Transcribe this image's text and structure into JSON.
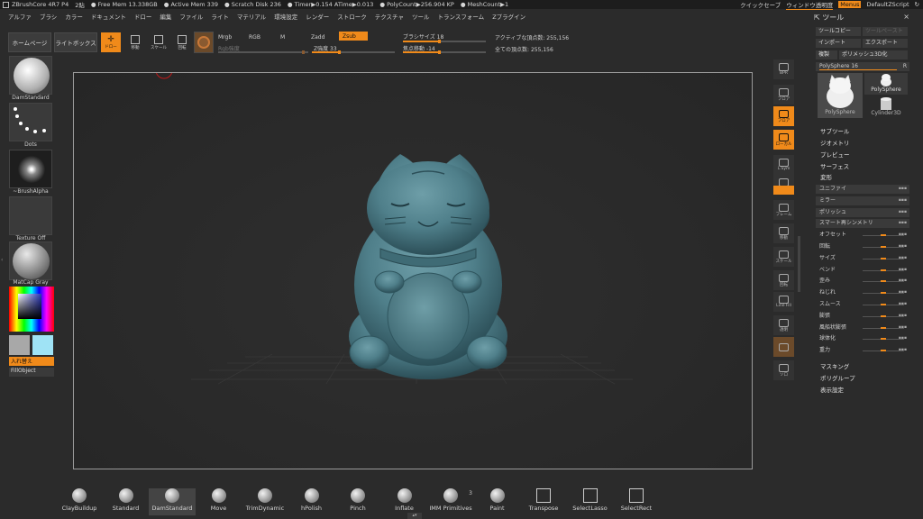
{
  "titlebar": {
    "app": "ZBrushCore 4R7 P4",
    "items": [
      "2貼",
      "● Free Mem 13.338GB",
      "● Active Mem 339",
      "● Scratch Disk 236",
      "● Timer▶0.154 ATime▶0.013",
      "● PolyCount▶256.904 KP",
      "● MeshCount▶1"
    ],
    "quicksave": "クイックセーブ",
    "transparency": "ウィンドウ透明度",
    "menus": "Menus",
    "script": "DefaultZScript"
  },
  "menubar": [
    "アルファ",
    "ブラシ",
    "カラー",
    "ドキュメント",
    "ドロー",
    "編集",
    "ファイル",
    "ライト",
    "マテリアル",
    "環境設定",
    "レンダー",
    "ストローク",
    "テクスチャ",
    "ツール",
    "トランスフォーム",
    "Zプラグイン"
  ],
  "topshelf": {
    "home": "ホームページ",
    "lightbox": "ライトボックス",
    "draw": "ドロー",
    "move": "移動",
    "scale": "スケール",
    "rotate": "回転",
    "mrgb": "Mrgb",
    "rgb": "RGB",
    "m": "M",
    "zadd": "Zadd",
    "zsub": "Zsub",
    "rgb_intensity": "Rgb強度",
    "z_intensity_label": "Z強度",
    "z_intensity": "33",
    "brush_size_label": "ブラシサイズ",
    "brush_size": "18",
    "focal_shift_label": "焦点移動",
    "focal_shift": "-14",
    "active_points_label": "アクティブな頂点数:",
    "active_points": "255,156",
    "total_points_label": "全ての頂点数:",
    "total_points": "255,156"
  },
  "leftshelf": {
    "brush": "DamStandard",
    "stroke": "Dots",
    "alpha": "~BrushAlpha",
    "texture": "Texture Off",
    "material": "MatCap Gray",
    "switch": "入れ替え",
    "fill": "FillObject",
    "colors": {
      "main": "#a8a8a8",
      "secondary": "#9fe3f5"
    }
  },
  "rightshelf": [
    {
      "label": "BPR",
      "active": false
    },
    {
      "label": "フロア",
      "active": false
    },
    {
      "label": "フロア",
      "active": true
    },
    {
      "label": "ローカル",
      "active": true
    },
    {
      "label": "L.Sym",
      "active": false
    },
    {
      "label": "QXYZ",
      "active": false
    },
    {
      "label": "",
      "active": true
    },
    {
      "label": "フレーム",
      "active": false
    },
    {
      "label": "移動",
      "active": false
    },
    {
      "label": "スケール",
      "active": false
    },
    {
      "label": "回転",
      "active": false
    },
    {
      "label": "Line Fill",
      "active": false
    },
    {
      "label": "透明",
      "active": false
    },
    {
      "label": "",
      "active": false
    },
    {
      "label": "ソロ",
      "active": false
    }
  ],
  "toolpanel": {
    "title": "ツール",
    "copy": "ツールコピー",
    "paste": "ツールペースト",
    "import": "インポート",
    "export": "エクスポート",
    "duplicate": "複製",
    "polymesh": "ポリメッシュ3D化",
    "current_tool": "PolySphere",
    "current_count": "16",
    "thumb_main": "PolySphere",
    "thumb_alt1": "PolySphere",
    "thumb_alt2": "Cylinder3D",
    "subtool": "サブツール",
    "geometry": "ジオメトリ",
    "preview": "プレビュー",
    "surface": "サーフェス",
    "deform": "変形",
    "deform_rows": [
      {
        "label": "ユニファイ",
        "slider": false,
        "boxed": true,
        "pos": 0
      },
      {
        "label": "ミラー",
        "slider": false,
        "boxed": true,
        "pos": 0
      },
      {
        "label": "ポリッシュ",
        "slider": false,
        "boxed": true,
        "pos": 0
      },
      {
        "label": "スマート再シンメトリ",
        "slider": false,
        "boxed": true,
        "pos": 0
      },
      {
        "label": "オフセット",
        "slider": true,
        "boxed": false,
        "pos": 0.5
      },
      {
        "label": "回転",
        "slider": true,
        "boxed": false,
        "pos": 0.5
      },
      {
        "label": "サイズ",
        "slider": true,
        "boxed": false,
        "pos": 0.5
      },
      {
        "label": "ベンド",
        "slider": true,
        "boxed": false,
        "pos": 0.5
      },
      {
        "label": "歪み",
        "slider": true,
        "boxed": false,
        "pos": 0.5
      },
      {
        "label": "ねじれ",
        "slider": true,
        "boxed": false,
        "pos": 0.5
      },
      {
        "label": "スムース",
        "slider": true,
        "boxed": false,
        "pos": 0.5
      },
      {
        "label": "膨張",
        "slider": true,
        "boxed": false,
        "pos": 0.5
      },
      {
        "label": "風船状膨張",
        "slider": true,
        "boxed": false,
        "pos": 0.5
      },
      {
        "label": "球体化",
        "slider": true,
        "boxed": false,
        "pos": 0.5
      },
      {
        "label": "重力",
        "slider": true,
        "boxed": false,
        "pos": 0.5
      }
    ],
    "masking": "マスキング",
    "polygroup": "ポリグループ",
    "display": "表示設定"
  },
  "bottomshelf": [
    {
      "label": "ClayBuildup",
      "active": false
    },
    {
      "label": "Standard",
      "active": false
    },
    {
      "label": "DamStandard",
      "active": true
    },
    {
      "label": "Move",
      "active": false
    },
    {
      "label": "TrimDynamic",
      "active": false
    },
    {
      "label": "hPolish",
      "active": false
    },
    {
      "label": "Pinch",
      "active": false
    },
    {
      "label": "Inflate",
      "active": false
    },
    {
      "label": "IMM Primitives",
      "active": false
    },
    {
      "label": "Paint",
      "active": false
    },
    {
      "label": "Transpose",
      "active": false
    },
    {
      "label": "SelectLasso",
      "active": false
    },
    {
      "label": "SelectRect",
      "active": false
    }
  ],
  "imm_count": "3",
  "accent": "#f08a1a",
  "model_color": "#4f7f8a"
}
